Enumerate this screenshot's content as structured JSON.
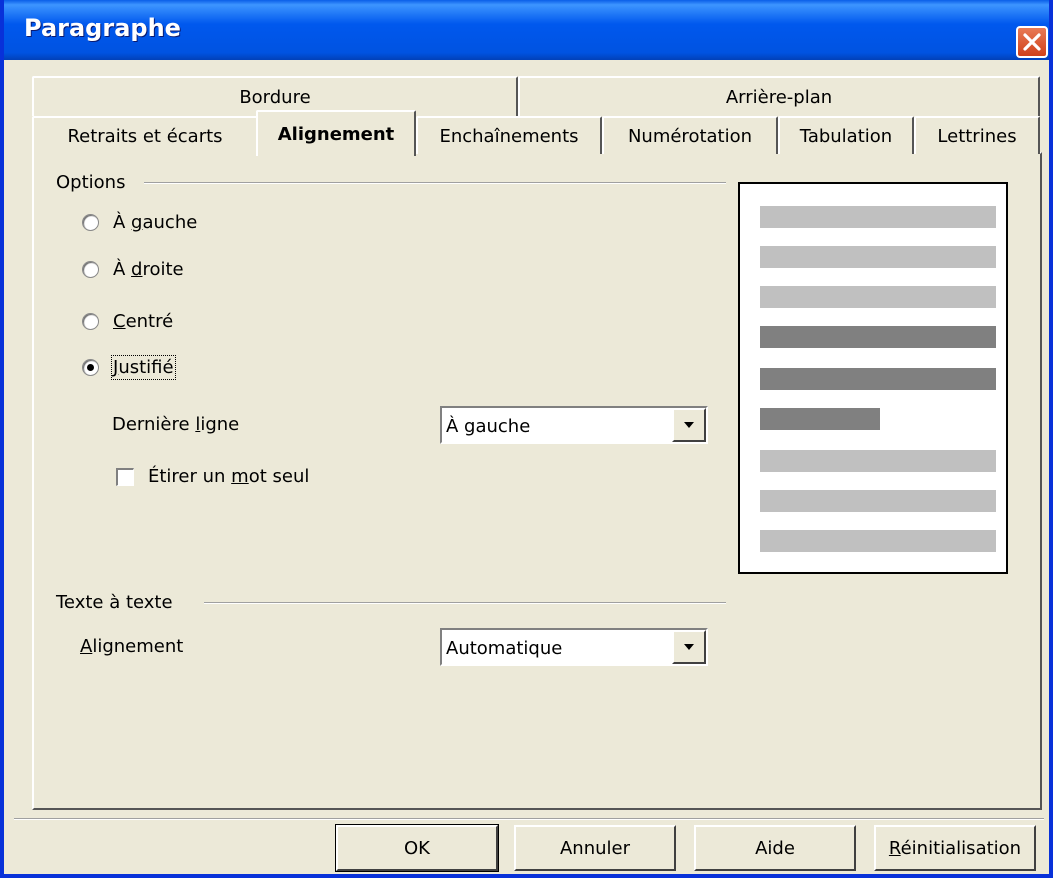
{
  "window": {
    "title": "Paragraphe"
  },
  "tabs_back": [
    {
      "label": "Bordure"
    },
    {
      "label": "Arrière-plan"
    }
  ],
  "tabs_front": [
    {
      "label": "Retraits et écarts"
    },
    {
      "label": "Alignement"
    },
    {
      "label": "Enchaînements"
    },
    {
      "label": "Numérotation"
    },
    {
      "label": "Tabulation"
    },
    {
      "label": "Lettrines"
    }
  ],
  "active_tab": "Alignement",
  "options": {
    "group_label": "Options",
    "radios": [
      {
        "prefix": "À ",
        "mnemonic": "g",
        "rest": "auche",
        "checked": false
      },
      {
        "prefix": "À ",
        "mnemonic": "d",
        "rest": "roite",
        "checked": false
      },
      {
        "prefix": "",
        "mnemonic": "C",
        "rest": "entré",
        "checked": false
      },
      {
        "prefix": "",
        "mnemonic": "J",
        "rest": "ustifié",
        "checked": true
      }
    ],
    "last_line": {
      "prefix": "Dernière ",
      "mnemonic": "l",
      "rest": "igne",
      "value": "À gauche"
    },
    "stretch": {
      "prefix": "Étirer un ",
      "mnemonic": "m",
      "rest": "ot seul",
      "checked": false
    }
  },
  "text_to_text": {
    "group_label": "Texte à texte",
    "alignment": {
      "prefix": "",
      "mnemonic": "A",
      "rest": "lignement",
      "value": "Automatique"
    }
  },
  "preview_colors": {
    "light": "#c0c0c0",
    "dark": "#808080"
  },
  "buttons": {
    "ok": "OK",
    "cancel": "Annuler",
    "help": "Aide",
    "reset": {
      "mnemonic": "R",
      "rest": "éinitialisation"
    }
  }
}
